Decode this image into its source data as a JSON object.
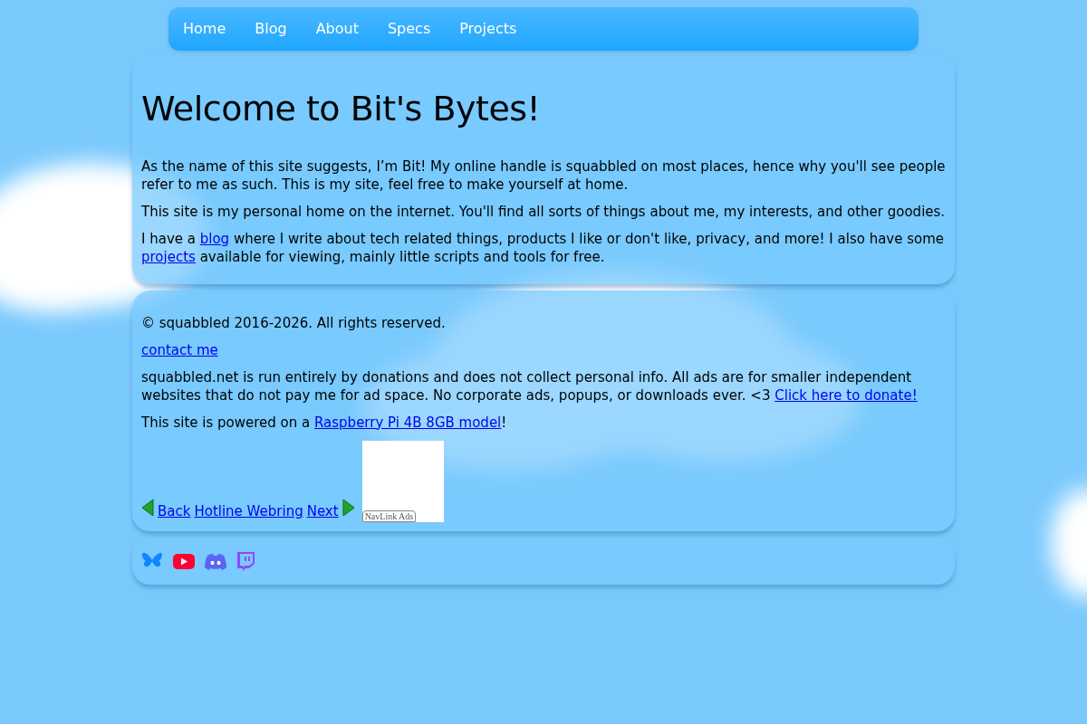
{
  "nav": [
    {
      "label": "Home"
    },
    {
      "label": "Blog"
    },
    {
      "label": "About"
    },
    {
      "label": "Specs"
    },
    {
      "label": "Projects"
    }
  ],
  "main": {
    "title": "Welcome to Bit's Bytes!",
    "paragraphs": [
      [
        {
          "text": "As the name of this site suggests, I’m Bit! My online handle is squabbled on most places, hence why you'll see people refer to me as such. This is my site, feel free to make yourself at home."
        }
      ],
      [
        {
          "text": "This site is my personal home on the internet. You'll find all sorts of things about me, my interests, and other goodies."
        }
      ],
      [
        {
          "text": "I have a "
        },
        {
          "link": "blog"
        },
        {
          "text": " where I write about tech related things, products I like or don't like, privacy, and more! I also have some "
        },
        {
          "link": "projects"
        },
        {
          "text": " available for viewing, mainly little scripts and tools for free."
        }
      ]
    ]
  },
  "footer": {
    "paragraphs": [
      [
        {
          "text": "© squabbled 2016-2026. All rights reserved."
        }
      ],
      [
        {
          "link": "contact me"
        }
      ],
      [
        {
          "text": "squabbled.net is run entirely by donations and does not collect personal info. All ads are for smaller independent websites that do not pay me for ad space. No corporate ads, popups, or downloads ever. <3 "
        },
        {
          "link": "Click here to donate!"
        }
      ],
      [
        {
          "text": "This site is powered on a "
        },
        {
          "link": "Raspberry Pi 4B 8GB model"
        },
        {
          "text": "!"
        }
      ]
    ],
    "webring": {
      "links": [
        "Back",
        "Hotline Webring",
        "Next"
      ],
      "ad_label": "NavLink Ads"
    }
  },
  "socials": [
    {
      "kind": "butterfly"
    },
    {
      "kind": "youtube"
    },
    {
      "kind": "discord"
    },
    {
      "kind": "twitch"
    }
  ]
}
